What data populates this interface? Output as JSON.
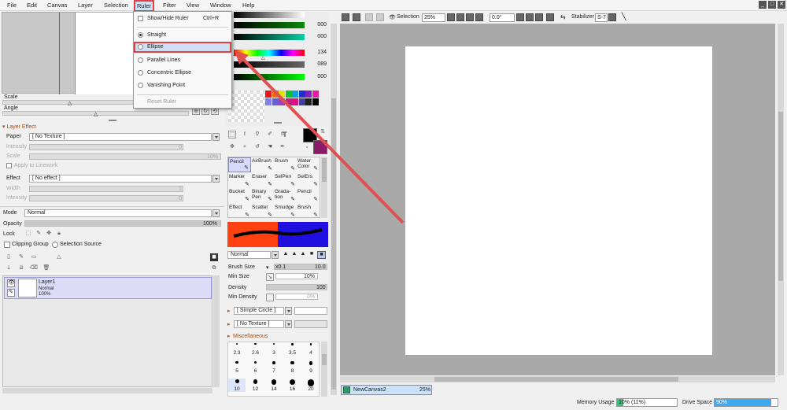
{
  "menubar": {
    "items": [
      "File",
      "Edit",
      "Canvas",
      "Layer",
      "Selection",
      "Ruler",
      "Filter",
      "View",
      "Window",
      "Help"
    ],
    "window_buttons": [
      "_",
      "□",
      "✕"
    ]
  },
  "ruler_menu": {
    "show_hide": {
      "label": "Show/Hide Ruler",
      "shortcut": "Ctrl+R"
    },
    "options": [
      "Straight",
      "Ellipse",
      "Parallel Lines",
      "Concentric Ellipse",
      "Vanishing Point"
    ],
    "reset": "Reset Ruler"
  },
  "navigator": {
    "scale_label": "Scale",
    "angle_label": "Angle"
  },
  "layer_effect": {
    "header": "Layer Effect",
    "paper_label": "Paper",
    "paper_value": "[ No Texture ]",
    "intensity_label": "Intensity",
    "intensity_value": "0",
    "scale_label": "Scale",
    "scale_value": "10%",
    "apply_linework": "Apply to Linework",
    "effect_label": "Effect",
    "effect_value": "[ No effect ]",
    "width_label": "Width",
    "width_value": "1",
    "intensity2_label": "Intensity",
    "intensity2_value": "0"
  },
  "layer_props": {
    "mode_label": "Mode",
    "mode_value": "Normal",
    "opacity_label": "Opacity",
    "opacity_value": "100%",
    "lock_label": "Lock",
    "clipping_group": "Clipping Group",
    "selection_source": "Selection Source"
  },
  "layers": [
    {
      "name": "Layer1",
      "mode": "Normal",
      "opacity": "100%"
    }
  ],
  "colors": {
    "slider_values": [
      "000",
      "000",
      "134",
      "089",
      "000"
    ],
    "swatches": [
      "#e81818",
      "#f06a10",
      "#e8e010",
      "#10c030",
      "#10a0e0",
      "#2030d0",
      "#8020c0",
      "#e020a0",
      "#8080f0",
      "#6060d0",
      "#a040c0",
      "#c02080",
      "#e01080",
      "#4040a0",
      "#202020",
      "#000000"
    ],
    "primary": "#000000",
    "secondary": "#8a1a6a"
  },
  "tools": {
    "names": [
      "Pencil",
      "AirBrush",
      "Brush",
      "Water Color",
      "Marker",
      "Eraser",
      "SelPen",
      "SelErs",
      "Bucket",
      "Binary Pen",
      "Grada-tion",
      "Pencil",
      "Effect",
      "Scatter",
      "Smudge",
      "Brush"
    ]
  },
  "brush": {
    "blend_mode": "Normal",
    "brush_size_label": "Brush Size",
    "brush_size_mult": "x0.1",
    "brush_size_value": "10.0",
    "min_size_label": "Min Size",
    "min_size_value": "10%",
    "density_label": "Density",
    "density_value": "100",
    "min_density_label": "Min Density",
    "min_density_value": "0%",
    "shape": "[ Simple Circle ]",
    "texture": "[ No Texture ]",
    "misc_label": "Miscellaneous",
    "sizes_row1": [
      "2.3",
      "2.6",
      "3",
      "3.5",
      "4"
    ],
    "sizes_row2": [
      "5",
      "6",
      "7",
      "8",
      "9"
    ],
    "sizes_row3": [
      "10",
      "12",
      "14",
      "16",
      "20"
    ]
  },
  "toolbar": {
    "selection_label": "Selection",
    "zoom": "25%",
    "angle": "0.0°",
    "stabilizer_label": "Stabilizer",
    "stabilizer_value": "S-7"
  },
  "canvas_tab": {
    "name": "NewCanvas2",
    "zoom": "25%"
  },
  "status": {
    "memory_label": "Memory Usage",
    "memory_value": "10% (11%)",
    "memory_fraction": 0.1,
    "drive_label": "Drive Space",
    "drive_value": "90%",
    "drive_fraction": 0.9
  }
}
